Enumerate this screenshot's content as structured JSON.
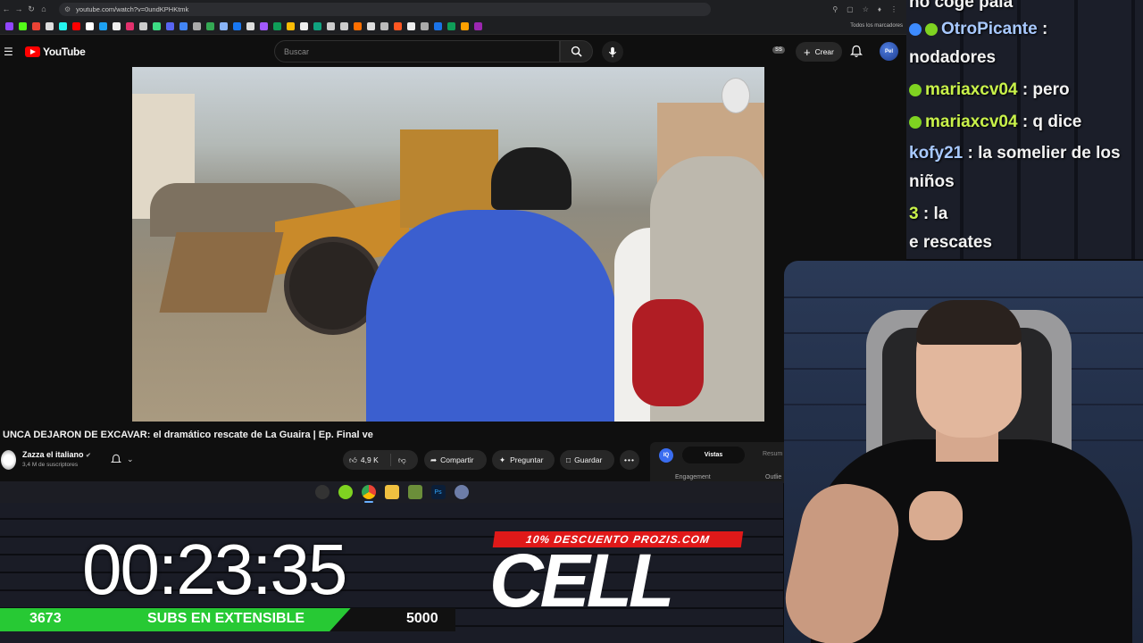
{
  "browser": {
    "url": "youtube.com/watch?v=0undKPHKtmk",
    "bookmarks_all": "Todos los marcadores"
  },
  "youtube": {
    "logo_text": "YouTube",
    "search_placeholder": "Buscar",
    "badge": "SS",
    "create_label": "Crear",
    "avatar_text": "Pel",
    "video_title": "UNCA DEJARON DE EXCAVAR: el dramático rescate de La Guaira | Ep. Final ve",
    "channel_name": "Zazza el italiano",
    "subscribers": "3,4 M de suscriptores",
    "likes": "4,9 K",
    "share_label": "Compartir",
    "ask_label": "Preguntar",
    "save_label": "Guardar",
    "extension": {
      "logo": "IQ",
      "tab_active": "Vistas",
      "tab_other": "Resum",
      "label_left": "Engagement",
      "label_right": "Outlie"
    }
  },
  "overlay": {
    "timer": "00:23:35",
    "subs_current": "3673",
    "subs_label": "SUBS EN EXTENSIBLE",
    "subs_goal": "5000",
    "subs_progress": 0.7346,
    "promo": "10% DESCUENTO PROZIS.COM",
    "sponsor_logo": "CELL"
  },
  "chat": {
    "lines": [
      {
        "user": "",
        "text": "no coge pala"
      },
      {
        "user": "OtroPicante",
        "text": " :"
      },
      {
        "user": "",
        "text": "nodadores"
      },
      {
        "user": "mariaxcv04",
        "text": " : pero"
      },
      {
        "user": "mariaxcv04",
        "text": " : q dice"
      },
      {
        "user": "kofy21",
        "text": " : la somelier de los"
      },
      {
        "user": "",
        "text": "niños"
      },
      {
        "user": "3",
        "text": " : la"
      },
      {
        "user": "",
        "text": "e rescates"
      }
    ]
  },
  "colors": {
    "youtube_red": "#ff0000",
    "subs_green": "#27c934",
    "promo_red": "#e01919",
    "chat_username": "#c9f24a"
  }
}
